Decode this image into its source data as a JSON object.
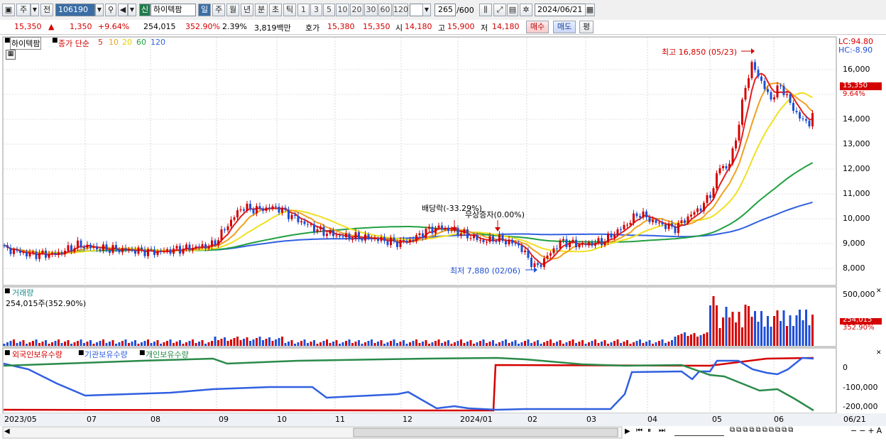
{
  "toolbar": {
    "stock_type": "주",
    "scope": "전",
    "code": "106190",
    "market_badge": "신",
    "name": "하이텍팜",
    "periods": [
      "일",
      "주",
      "월",
      "년",
      "분",
      "초",
      "틱"
    ],
    "active_period": "일",
    "intervals": [
      "1",
      "3",
      "5",
      "10",
      "20",
      "30",
      "60",
      "120"
    ],
    "count": "265",
    "count_max": "/600",
    "date": "2024/06/21"
  },
  "quote": {
    "price": "15,350",
    "arrow": "▲",
    "change": "1,350",
    "change_pct": "+9.64%",
    "volume": "254,015",
    "volume_pct": "352.90%",
    "turnover_pct": "2.39%",
    "amount": "3,819백만",
    "bid_label": "호가",
    "ask_price": "15,380",
    "bid_price": "15,350",
    "open_label": "시",
    "open": "14,180",
    "high_label": "고",
    "high": "15,900",
    "low_label": "저",
    "low": "14,180",
    "buy_button": "매수",
    "sell_button": "매도",
    "eval_button": "평"
  },
  "price_panel": {
    "title": "하이텍팜",
    "indicator": "종가 단순",
    "ma_periods": [
      "5",
      "10",
      "20",
      "60",
      "120"
    ],
    "ma_colors": [
      "#e02020",
      "#f0a020",
      "#f0e020",
      "#20a040",
      "#3060e0"
    ],
    "lc": "LC:94.80",
    "hc": "HC:-8.90",
    "high_label": "최고 16,850 (05/23)",
    "low_label": "최저 7,880 (02/06)",
    "event1": "배당락(-33.29%)",
    "event2": "무상증자(0.00%)",
    "current_price_tag": "15,350",
    "current_pct_tag": "9.64%",
    "y_ticks": [
      "16,000",
      "15,000",
      "14,000",
      "13,000",
      "12,000",
      "11,000",
      "10,000",
      "9,000",
      "8,000"
    ]
  },
  "volume_panel": {
    "title": "거래량",
    "summary": "254,015주(352.90%)",
    "y_tick": "500,000",
    "current_tag": "254,015",
    "current_pct": "352.90%"
  },
  "holdings_panel": {
    "series": [
      "외국인보유수량",
      "기관보유수량",
      "개인보유수량"
    ],
    "series_colors": [
      "#d40000",
      "#3060e0",
      "#2a8a4a"
    ],
    "y_ticks": [
      "0",
      "-100,000",
      "-200,000"
    ]
  },
  "x_axis": {
    "labels": [
      "2023/05",
      "07",
      "08",
      "09",
      "10",
      "11",
      "12",
      "2024/01",
      "02",
      "03",
      "04",
      "05",
      "06"
    ],
    "end_label": "06/21"
  }
}
